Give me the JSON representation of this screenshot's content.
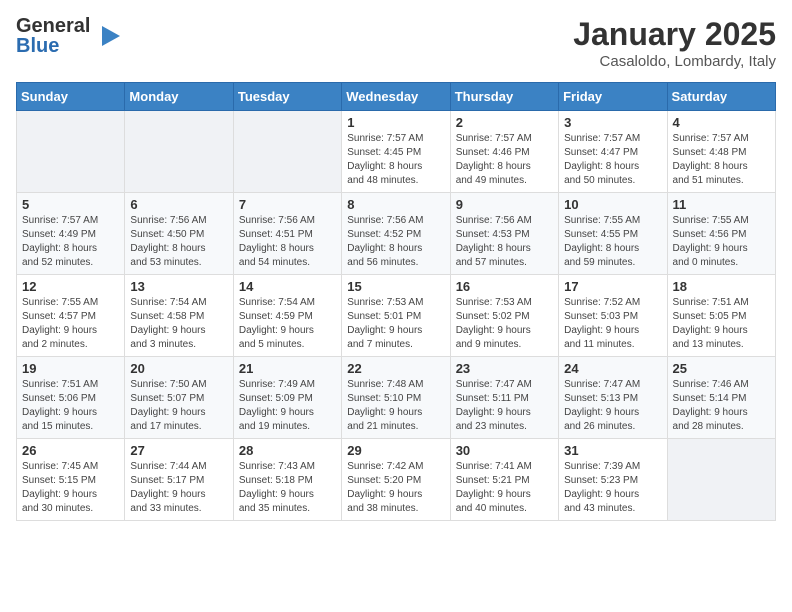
{
  "logo": {
    "general": "General",
    "blue": "Blue"
  },
  "title": "January 2025",
  "location": "Casaloldo, Lombardy, Italy",
  "weekdays": [
    "Sunday",
    "Monday",
    "Tuesday",
    "Wednesday",
    "Thursday",
    "Friday",
    "Saturday"
  ],
  "weeks": [
    [
      {
        "day": "",
        "info": ""
      },
      {
        "day": "",
        "info": ""
      },
      {
        "day": "",
        "info": ""
      },
      {
        "day": "1",
        "info": "Sunrise: 7:57 AM\nSunset: 4:45 PM\nDaylight: 8 hours\nand 48 minutes."
      },
      {
        "day": "2",
        "info": "Sunrise: 7:57 AM\nSunset: 4:46 PM\nDaylight: 8 hours\nand 49 minutes."
      },
      {
        "day": "3",
        "info": "Sunrise: 7:57 AM\nSunset: 4:47 PM\nDaylight: 8 hours\nand 50 minutes."
      },
      {
        "day": "4",
        "info": "Sunrise: 7:57 AM\nSunset: 4:48 PM\nDaylight: 8 hours\nand 51 minutes."
      }
    ],
    [
      {
        "day": "5",
        "info": "Sunrise: 7:57 AM\nSunset: 4:49 PM\nDaylight: 8 hours\nand 52 minutes."
      },
      {
        "day": "6",
        "info": "Sunrise: 7:56 AM\nSunset: 4:50 PM\nDaylight: 8 hours\nand 53 minutes."
      },
      {
        "day": "7",
        "info": "Sunrise: 7:56 AM\nSunset: 4:51 PM\nDaylight: 8 hours\nand 54 minutes."
      },
      {
        "day": "8",
        "info": "Sunrise: 7:56 AM\nSunset: 4:52 PM\nDaylight: 8 hours\nand 56 minutes."
      },
      {
        "day": "9",
        "info": "Sunrise: 7:56 AM\nSunset: 4:53 PM\nDaylight: 8 hours\nand 57 minutes."
      },
      {
        "day": "10",
        "info": "Sunrise: 7:55 AM\nSunset: 4:55 PM\nDaylight: 8 hours\nand 59 minutes."
      },
      {
        "day": "11",
        "info": "Sunrise: 7:55 AM\nSunset: 4:56 PM\nDaylight: 9 hours\nand 0 minutes."
      }
    ],
    [
      {
        "day": "12",
        "info": "Sunrise: 7:55 AM\nSunset: 4:57 PM\nDaylight: 9 hours\nand 2 minutes."
      },
      {
        "day": "13",
        "info": "Sunrise: 7:54 AM\nSunset: 4:58 PM\nDaylight: 9 hours\nand 3 minutes."
      },
      {
        "day": "14",
        "info": "Sunrise: 7:54 AM\nSunset: 4:59 PM\nDaylight: 9 hours\nand 5 minutes."
      },
      {
        "day": "15",
        "info": "Sunrise: 7:53 AM\nSunset: 5:01 PM\nDaylight: 9 hours\nand 7 minutes."
      },
      {
        "day": "16",
        "info": "Sunrise: 7:53 AM\nSunset: 5:02 PM\nDaylight: 9 hours\nand 9 minutes."
      },
      {
        "day": "17",
        "info": "Sunrise: 7:52 AM\nSunset: 5:03 PM\nDaylight: 9 hours\nand 11 minutes."
      },
      {
        "day": "18",
        "info": "Sunrise: 7:51 AM\nSunset: 5:05 PM\nDaylight: 9 hours\nand 13 minutes."
      }
    ],
    [
      {
        "day": "19",
        "info": "Sunrise: 7:51 AM\nSunset: 5:06 PM\nDaylight: 9 hours\nand 15 minutes."
      },
      {
        "day": "20",
        "info": "Sunrise: 7:50 AM\nSunset: 5:07 PM\nDaylight: 9 hours\nand 17 minutes."
      },
      {
        "day": "21",
        "info": "Sunrise: 7:49 AM\nSunset: 5:09 PM\nDaylight: 9 hours\nand 19 minutes."
      },
      {
        "day": "22",
        "info": "Sunrise: 7:48 AM\nSunset: 5:10 PM\nDaylight: 9 hours\nand 21 minutes."
      },
      {
        "day": "23",
        "info": "Sunrise: 7:47 AM\nSunset: 5:11 PM\nDaylight: 9 hours\nand 23 minutes."
      },
      {
        "day": "24",
        "info": "Sunrise: 7:47 AM\nSunset: 5:13 PM\nDaylight: 9 hours\nand 26 minutes."
      },
      {
        "day": "25",
        "info": "Sunrise: 7:46 AM\nSunset: 5:14 PM\nDaylight: 9 hours\nand 28 minutes."
      }
    ],
    [
      {
        "day": "26",
        "info": "Sunrise: 7:45 AM\nSunset: 5:15 PM\nDaylight: 9 hours\nand 30 minutes."
      },
      {
        "day": "27",
        "info": "Sunrise: 7:44 AM\nSunset: 5:17 PM\nDaylight: 9 hours\nand 33 minutes."
      },
      {
        "day": "28",
        "info": "Sunrise: 7:43 AM\nSunset: 5:18 PM\nDaylight: 9 hours\nand 35 minutes."
      },
      {
        "day": "29",
        "info": "Sunrise: 7:42 AM\nSunset: 5:20 PM\nDaylight: 9 hours\nand 38 minutes."
      },
      {
        "day": "30",
        "info": "Sunrise: 7:41 AM\nSunset: 5:21 PM\nDaylight: 9 hours\nand 40 minutes."
      },
      {
        "day": "31",
        "info": "Sunrise: 7:39 AM\nSunset: 5:23 PM\nDaylight: 9 hours\nand 43 minutes."
      },
      {
        "day": "",
        "info": ""
      }
    ]
  ]
}
